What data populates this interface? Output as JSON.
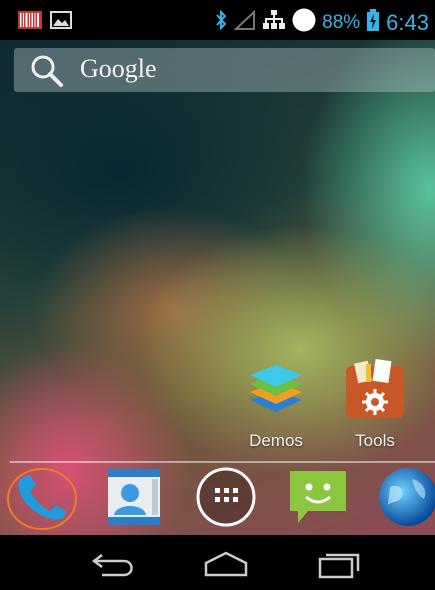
{
  "status_bar": {
    "icons": [
      "barcode-icon",
      "image-notification-icon",
      "bluetooth-icon",
      "signal-icon",
      "network-icon",
      "circle-icon",
      "battery-icon"
    ],
    "battery_percent": "88%",
    "time": "6:43"
  },
  "search": {
    "label": "Google",
    "icon": "search-icon"
  },
  "shortcuts": [
    {
      "label": "Demos",
      "icon": "stacked-layers-icon"
    },
    {
      "label": "Tools",
      "icon": "toolbox-icon"
    }
  ],
  "dock": [
    {
      "name": "phone",
      "icon": "phone-icon",
      "highlighted": true
    },
    {
      "name": "contacts",
      "icon": "contacts-icon"
    },
    {
      "name": "all-apps",
      "icon": "app-drawer-icon"
    },
    {
      "name": "messaging",
      "icon": "messaging-icon"
    },
    {
      "name": "browser",
      "icon": "globe-icon"
    }
  ],
  "navigation": [
    "back-icon",
    "home-icon",
    "recent-apps-icon"
  ],
  "colors": {
    "status_accent": "#35b4e8",
    "highlight_ring": "#f07a2a"
  }
}
